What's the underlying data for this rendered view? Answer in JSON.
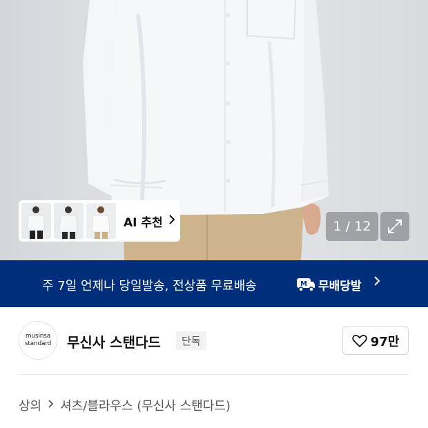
{
  "gallery": {
    "page_counter": "1 / 12",
    "ai_recommend_label": "AI 추천",
    "icons": {
      "expand": "expand-icon",
      "chevron": "chevron-right-icon"
    }
  },
  "banner": {
    "text": "주 7일 언제나 당일발송, 전상품 무료배송",
    "badge_label": "무배당발",
    "badge_icon_letter": "M",
    "background": "#002e7b"
  },
  "brand": {
    "logo_line1": "musinsa",
    "logo_line2": "standard",
    "name": "무신사 스탠다드",
    "exclusive_tag": "단독",
    "like_count": "97만"
  },
  "breadcrumb": {
    "category": "상의",
    "subcategory": "셔츠/블라우스 (무신사 스탠다드)"
  }
}
